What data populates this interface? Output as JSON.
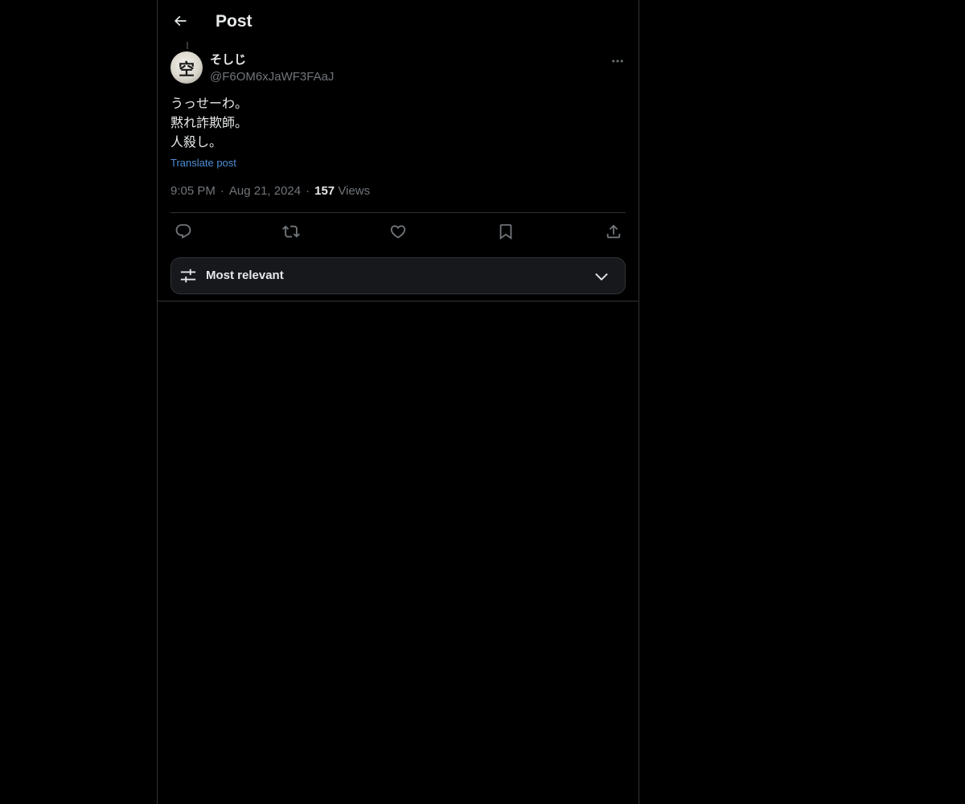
{
  "header": {
    "back_icon": "arrow-left-icon",
    "title": "Post"
  },
  "post": {
    "author": {
      "display_name": "そしじ",
      "handle": "@F6OM6xJaWF3FAaJ",
      "avatar_glyph": "空"
    },
    "text_lines": [
      "うっせーわ。",
      "黙れ詐欺師。",
      "人殺し。"
    ],
    "translate_label": "Translate post",
    "time": "9:05 PM",
    "date": "Aug 21, 2024",
    "separator": "·",
    "views_count": "157",
    "views_label": "Views",
    "actions": [
      {
        "name": "reply",
        "icon": "reply-icon"
      },
      {
        "name": "repost",
        "icon": "repost-icon"
      },
      {
        "name": "like",
        "icon": "heart-icon"
      },
      {
        "name": "bookmark",
        "icon": "bookmark-icon"
      },
      {
        "name": "share",
        "icon": "share-icon"
      }
    ]
  },
  "replies_sort": {
    "icon": "sliders-icon",
    "label": "Most relevant",
    "chevron": "chevron-down-icon"
  },
  "colors": {
    "background": "#000000",
    "text_primary": "#e7e9ea",
    "text_secondary": "#71767b",
    "link": "#4d8fd6",
    "border": "#2f3336"
  }
}
